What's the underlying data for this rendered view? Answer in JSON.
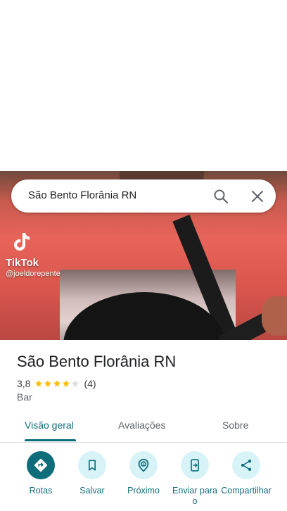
{
  "search": {
    "query": "São Bento Florânia RN"
  },
  "hero": {
    "watermark_brand": "TikTok",
    "watermark_user": "@joeldorepente"
  },
  "place": {
    "name": "São Bento Florânia RN",
    "rating": "3,8",
    "stars_filled": 4,
    "stars_total": 5,
    "review_count": "(4)",
    "category": "Bar"
  },
  "tabs": [
    {
      "label": "Visão geral",
      "active": true
    },
    {
      "label": "Avaliações",
      "active": false
    },
    {
      "label": "Sobre",
      "active": false
    }
  ],
  "actions": [
    {
      "label": "Rotas",
      "icon": "directions-icon"
    },
    {
      "label": "Salvar",
      "icon": "bookmark-icon"
    },
    {
      "label": "Próximo",
      "icon": "nearby-icon"
    },
    {
      "label": "Enviar para o",
      "icon": "send-to-phone-icon"
    },
    {
      "label": "Compartilhar",
      "icon": "share-icon"
    }
  ],
  "colors": {
    "accent": "#0f6d7a",
    "accent_light": "#d7f3f7",
    "star": "#fbbc04",
    "star_empty": "#dadce0"
  }
}
